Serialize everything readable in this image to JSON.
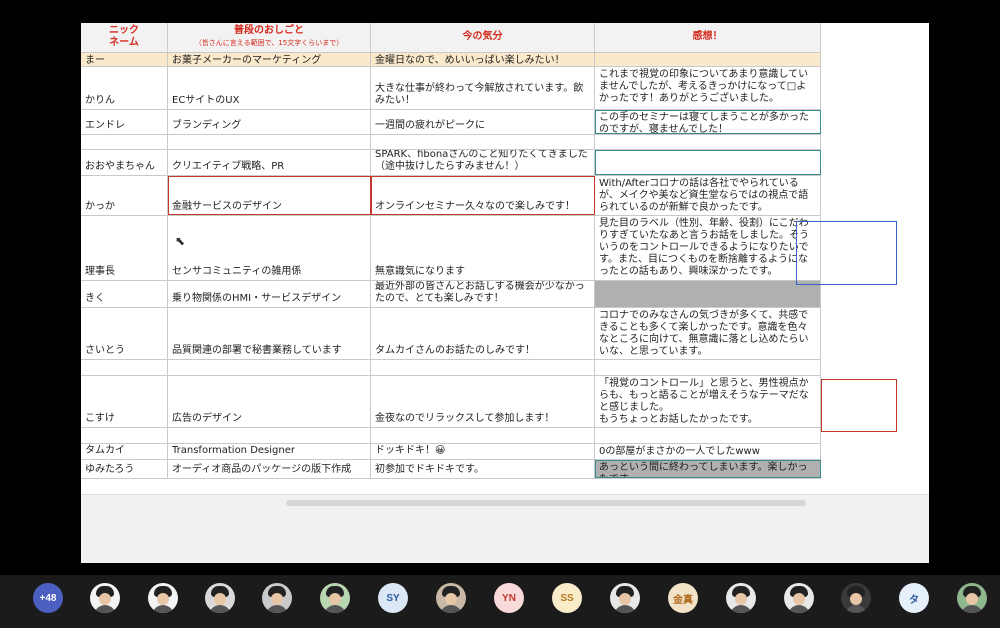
{
  "headers": {
    "nickname": "ニック\nネーム",
    "job": "普段のおしごと",
    "job_sub": "（皆さんに言える範囲で、15文字くらいまで）",
    "mood": "今の気分",
    "impression": "感想！"
  },
  "rows": [
    {
      "name": "まー",
      "job": "お菓子メーカーのマーケティング",
      "mood": "金曜日なので、めいいっぱい楽しみたい！",
      "impression": ""
    },
    {
      "name": "かりん",
      "job": "ECサイトのUX",
      "mood": "大きな仕事が終わって今解放されています。飲みたい！",
      "impression": "これまで視覚の印象についてあまり意識していませんでしたが、考えるきっかけになって□よかったです！ありがとうございました。"
    },
    {
      "name": "エンドレ",
      "job": "ブランディング",
      "mood": "一週間の疲れがピークに",
      "impression": "この手のセミナーは寝てしまうことが多かったのですが、寝ませんでした！"
    },
    {
      "name": "",
      "job": "",
      "mood": "",
      "impression": ""
    },
    {
      "name": "おおやまちゃん",
      "job": "クリエイティブ戦略、PR",
      "mood": "SPARK、fibonaさんのこと知りたくてきました（途中抜けしたらすみません！）",
      "impression": ""
    },
    {
      "name": "かっか",
      "job": "金融サービスのデザイン",
      "mood": "オンラインセミナー久々なので楽しみです！",
      "impression": "With/Afterコロナの話は各社でやられているが、メイクや美など資生堂ならではの視点で語られているのが新鮮で良かったです。"
    },
    {
      "name": "理事長",
      "job": "センサコミュニティの雑用係",
      "mood": "無意識気になります",
      "impression": "見た目のラベル（性別、年齢、役割）にこだわりすぎていたなあと言うお話をしました。そういうのをコントロールできるようになりたいです。また、目につくものを断捨離するようになったとの話もあり、興味深かったです。"
    },
    {
      "name": "きく",
      "job": "乗り物関係のHMI・サービスデザイン",
      "mood": "最近外部の皆さんとお話しする機会が少なかったので、とても楽しみです！",
      "impression": ""
    },
    {
      "name": "さいとう",
      "job": "品質関連の部署で秘書業務しています",
      "mood": "タムカイさんのお話たのしみです！",
      "impression": "コロナでのみなさんの気づきが多くて、共感できることも多くて楽しかったです。意識を色々なところに向けて、無意識に落とし込めたらいいな、と思っています。"
    },
    {
      "name": "",
      "job": "",
      "mood": "",
      "impression": ""
    },
    {
      "name": "こすけ",
      "job": "広告のデザイン",
      "mood": "金夜なのでリラックスして参加します！",
      "impression": "「視覚のコントロール」と思うと、男性視点からも、もっと語ることが増えそうなテーマだなと感じました。\nもうちょっとお話したかったです。"
    },
    {
      "name": "",
      "job": "",
      "mood": "",
      "impression": ""
    },
    {
      "name": "タムカイ",
      "job": "Transformation Designer",
      "mood": "ドッキドキ！😀",
      "impression": "0の部屋がまさかの一人でしたwww"
    },
    {
      "name": "ゆみたろう",
      "job": "オーディオ商品のパッケージの版下作成",
      "mood": "初参加でドキドキです。",
      "impression": "あっという間に終わってしまいます。楽しかったです。"
    }
  ],
  "participants": [
    {
      "label": "+48",
      "color": "#4a5fbf"
    },
    {
      "label": "",
      "color": "#f4f4f4"
    },
    {
      "label": "",
      "color": "#f4f4f4"
    },
    {
      "label": "",
      "color": "#d9d9d9"
    },
    {
      "label": "",
      "color": "#c9c9c9"
    },
    {
      "label": "",
      "color": "#b8d6b0"
    },
    {
      "label": "SY",
      "color": "#dbe7f4"
    },
    {
      "label": "",
      "color": "#c9b8a6"
    },
    {
      "label": "YN",
      "color": "#f8dada"
    },
    {
      "label": "SS",
      "color": "#f8ecc9"
    },
    {
      "label": "",
      "color": "#e8e8e8"
    },
    {
      "label": "金真",
      "color": "#f2e2c6"
    },
    {
      "label": "",
      "color": "#e8e8e8"
    },
    {
      "label": "",
      "color": "#e8e8e8"
    },
    {
      "label": "",
      "color": "#3a3a3a"
    },
    {
      "label": "タ",
      "color": "#e6f0fa"
    },
    {
      "label": "",
      "color": "#8fb58a"
    }
  ]
}
